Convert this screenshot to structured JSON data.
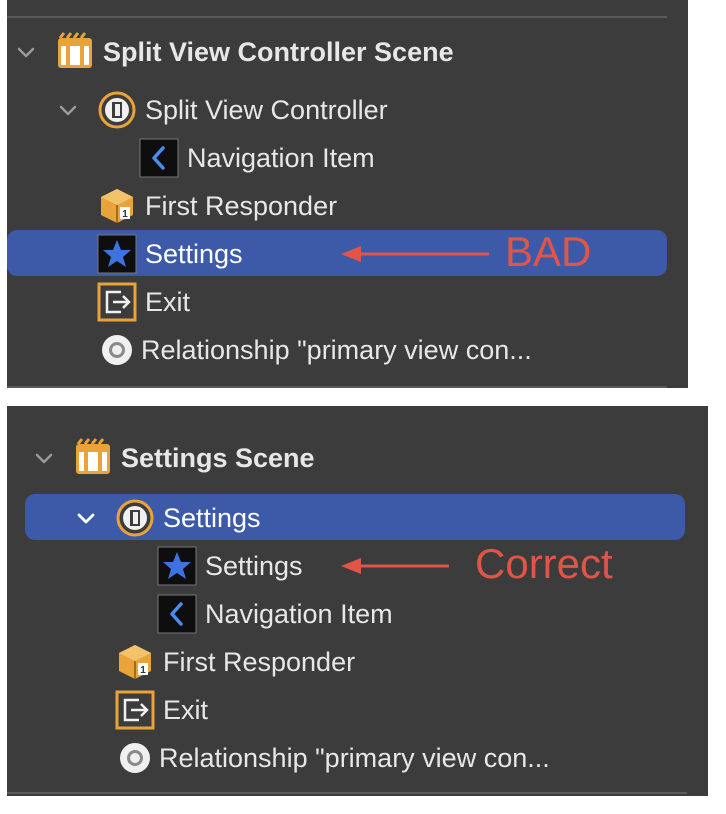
{
  "panel1": {
    "scene_title": "Split View Controller Scene",
    "controller": "Split View Controller",
    "nav_item": "Navigation Item",
    "first_responder": "First Responder",
    "settings": "Settings",
    "exit": "Exit",
    "relationship": "Relationship \"primary view con...",
    "annotation": "BAD"
  },
  "panel2": {
    "scene_title": "Settings Scene",
    "controller": "Settings",
    "settings": "Settings",
    "nav_item": "Navigation Item",
    "first_responder": "First Responder",
    "exit": "Exit",
    "relationship": "Relationship \"primary view con...",
    "annotation": "Correct"
  },
  "colors": {
    "panel_bg": "#3c3c3c",
    "selection": "#3d5aa8",
    "annotation": "#e05548",
    "icon_accent": "#e8a33a"
  },
  "icons": [
    "chevron-down-icon",
    "scene-icon",
    "view-controller-icon",
    "navigation-item-icon",
    "first-responder-icon",
    "star-icon",
    "exit-icon",
    "relationship-icon"
  ]
}
